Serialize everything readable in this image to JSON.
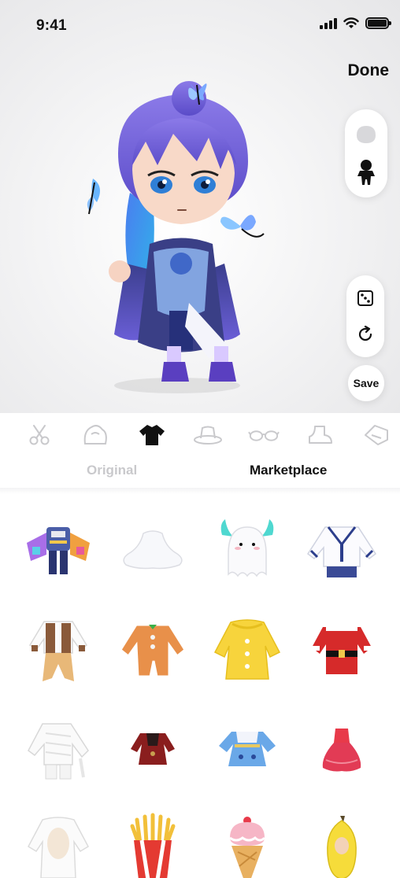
{
  "status_bar": {
    "time": "9:41"
  },
  "header": {
    "done_label": "Done"
  },
  "view_toggle": {
    "items": [
      "head-icon",
      "full-body-icon"
    ]
  },
  "tools": {
    "items": [
      "dice-icon",
      "rotate-icon"
    ],
    "save_label": "Save"
  },
  "categories": {
    "items": [
      "scissors-icon",
      "hair-icon",
      "top-icon",
      "hat-icon",
      "glasses-icon",
      "shoe-icon",
      "tag-icon"
    ],
    "selected": "top-icon"
  },
  "sub_tabs": {
    "original_label": "Original",
    "marketplace_label": "Marketplace",
    "selected": "Marketplace"
  },
  "outfits": [
    [
      "colorful-mecha-outfit",
      "white-ghost-sheet",
      "ghost-with-blue-flames",
      "sailor-uniform"
    ],
    [
      "brown-vest-outfit",
      "gingerbread-suit",
      "yellow-raincoat",
      "santa-suit"
    ],
    [
      "white-mummy-wrap",
      "red-armored-dress",
      "blue-white-dress",
      "red-ruffle-dress"
    ],
    [
      "white-onesie",
      "french-fries-costume",
      "ice-cream-cone-costume",
      "banana-costume"
    ]
  ],
  "colors": {
    "accent": "#111111",
    "inactive": "#c9c9cc",
    "avatar_hair": "#7b6ae0"
  }
}
